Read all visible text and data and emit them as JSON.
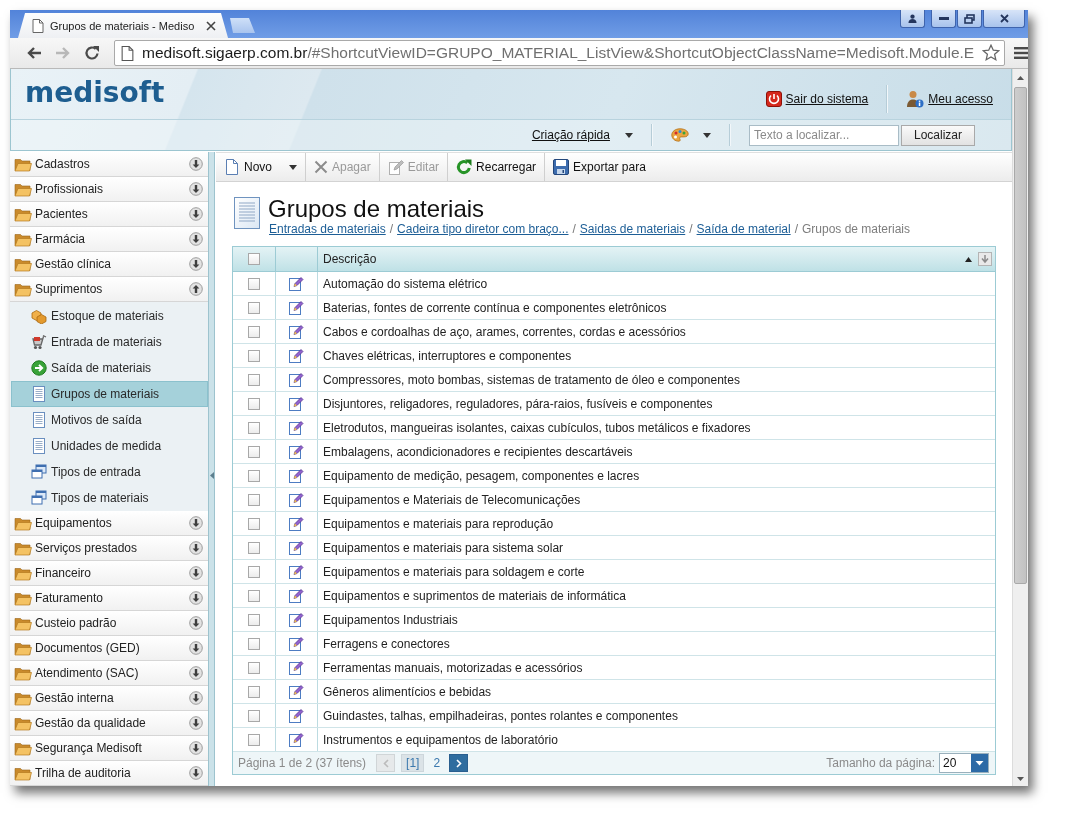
{
  "browser": {
    "tab": {
      "title": "Grupos de materiais - Mediso"
    },
    "address": {
      "domain": "medisoft.sigaerp.com.br",
      "path": "/#ShortcutViewID=GRUPO_MATERIAL_ListView&ShortcutObjectClassName=Medisoft.Module.E"
    }
  },
  "header": {
    "logo": "medisoft",
    "links": [
      {
        "label": "Sair do sistema",
        "kind": "logout"
      },
      {
        "label": "Meu acesso",
        "kind": "account"
      }
    ],
    "quick_create": {
      "label": "Criação rápida"
    },
    "search": {
      "placeholder": "Texto a localizar...",
      "button": "Localizar"
    }
  },
  "sidebar": {
    "groups": [
      {
        "label": "Cadastros",
        "expanded": false
      },
      {
        "label": "Profissionais",
        "expanded": false
      },
      {
        "label": "Pacientes",
        "expanded": false
      },
      {
        "label": "Farmácia",
        "expanded": false
      },
      {
        "label": "Gestão clínica",
        "expanded": false
      },
      {
        "label": "Suprimentos",
        "expanded": true,
        "children": [
          {
            "label": "Estoque de materiais",
            "kind": "stock",
            "selected": false
          },
          {
            "label": "Entrada de materiais",
            "kind": "cart",
            "selected": false
          },
          {
            "label": "Saída de materiais",
            "kind": "exit",
            "selected": false
          },
          {
            "label": "Grupos de materiais",
            "kind": "list",
            "selected": true
          },
          {
            "label": "Motivos de saída",
            "kind": "list",
            "selected": false
          },
          {
            "label": "Unidades de medida",
            "kind": "list",
            "selected": false
          },
          {
            "label": "Tipos de entrada",
            "kind": "stack",
            "selected": false
          },
          {
            "label": "Tipos de materiais",
            "kind": "stack",
            "selected": false
          }
        ]
      },
      {
        "label": "Equipamentos",
        "expanded": false
      },
      {
        "label": "Serviços prestados",
        "expanded": false
      },
      {
        "label": "Financeiro",
        "expanded": false
      },
      {
        "label": "Faturamento",
        "expanded": false
      },
      {
        "label": "Custeio padrão",
        "expanded": false
      },
      {
        "label": "Documentos (GED)",
        "expanded": false
      },
      {
        "label": "Atendimento (SAC)",
        "expanded": false
      },
      {
        "label": "Gestão interna",
        "expanded": false
      },
      {
        "label": "Gestão da qualidade",
        "expanded": false
      },
      {
        "label": "Segurança Medisoft",
        "expanded": false
      },
      {
        "label": "Trilha de auditoria",
        "expanded": false
      }
    ]
  },
  "toolbar": {
    "buttons": [
      {
        "label": "Novo",
        "kind": "new",
        "disabled": false,
        "dropdown": true
      },
      {
        "label": "Apagar",
        "kind": "delete",
        "disabled": true,
        "dropdown": false
      },
      {
        "label": "Editar",
        "kind": "edit",
        "disabled": true,
        "dropdown": false
      },
      {
        "label": "Recarregar",
        "kind": "reload",
        "disabled": false,
        "dropdown": false
      },
      {
        "label": "Exportar para",
        "kind": "export",
        "disabled": false,
        "dropdown": false
      }
    ]
  },
  "view": {
    "title": "Grupos de materiais",
    "breadcrumb": {
      "separator": "/",
      "items": [
        {
          "label": "Entradas de materiais",
          "link": true
        },
        {
          "label": "Cadeira tipo diretor com braço...",
          "link": true
        },
        {
          "label": "Saidas de materiais",
          "link": true
        },
        {
          "label": "Saída de material",
          "link": true
        },
        {
          "label": "Grupos de materiais",
          "link": false
        }
      ]
    }
  },
  "table": {
    "select_all": {
      "checked": false
    },
    "columns": [
      {
        "label": "Descrição",
        "sorted_ascending": true
      }
    ],
    "rows": [
      {
        "checked": false,
        "description": "Automação do sistema elétrico"
      },
      {
        "checked": false,
        "description": "Baterias, fontes de corrente contínua e componentes eletrônicos"
      },
      {
        "checked": false,
        "description": "Cabos e cordoalhas de aço, arames, correntes, cordas e acessórios"
      },
      {
        "checked": false,
        "description": "Chaves elétricas, interruptores e componentes"
      },
      {
        "checked": false,
        "description": "Compressores, moto bombas, sistemas de tratamento de óleo e componentes"
      },
      {
        "checked": false,
        "description": "Disjuntores, religadores, reguladores, pára-raios, fusíveis e componentes"
      },
      {
        "checked": false,
        "description": "Eletrodutos, mangueiras isolantes, caixas cubículos, tubos metálicos e fixadores"
      },
      {
        "checked": false,
        "description": "Embalagens, acondicionadores e recipientes descartáveis"
      },
      {
        "checked": false,
        "description": "Equipamento de medição, pesagem, componentes e lacres"
      },
      {
        "checked": false,
        "description": "Equipamentos e Materiais de Telecomunicações"
      },
      {
        "checked": false,
        "description": "Equipamentos e materiais para reprodução"
      },
      {
        "checked": false,
        "description": "Equipamentos e materiais para sistema solar"
      },
      {
        "checked": false,
        "description": "Equipamentos e materiais para soldagem e corte"
      },
      {
        "checked": false,
        "description": "Equipamentos e suprimentos de materiais de informática"
      },
      {
        "checked": false,
        "description": "Equipamentos Industriais"
      },
      {
        "checked": false,
        "description": "Ferragens e conectores"
      },
      {
        "checked": false,
        "description": "Ferramentas manuais, motorizadas e acessórios"
      },
      {
        "checked": false,
        "description": "Gêneros alimentícios e bebidas"
      },
      {
        "checked": false,
        "description": "Guindastes, talhas, empilhadeiras, pontes rolantes e componentes"
      },
      {
        "checked": false,
        "description": "Instrumentos e equipamentos de laboratório"
      }
    ]
  },
  "pager": {
    "summary": "Página 1 de 2 (37 ítens)",
    "previous": {
      "disabled": true
    },
    "next": {
      "disabled": false
    },
    "pages": [
      {
        "label": "[1]",
        "selected": true
      },
      {
        "label": "2",
        "selected": false
      }
    ],
    "page_size": {
      "label": "Tamanho da página:",
      "value": "20"
    }
  }
}
